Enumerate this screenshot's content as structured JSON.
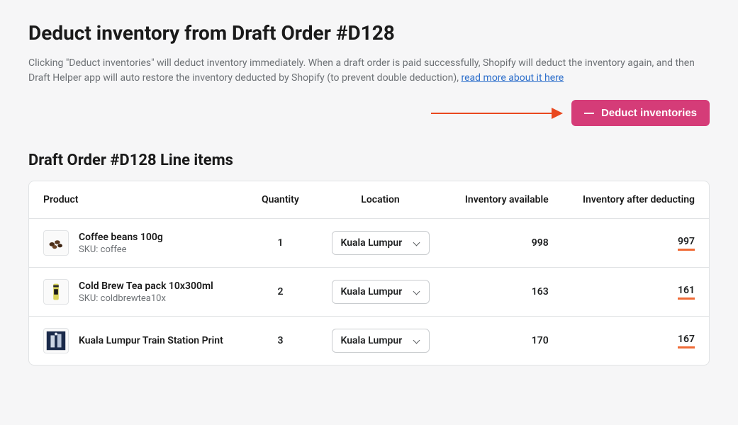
{
  "page": {
    "title": "Deduct inventory from Draft Order #D128",
    "description_pre": "Clicking \"Deduct inventories\" will deduct inventory immediately. When a draft order is paid successfully, Shopify will deduct the inventory again, and then Draft Helper app will auto restore the inventory deducted by Shopify (to prevent double deduction), ",
    "description_link": "read more about it here"
  },
  "actions": {
    "deduct_label": "Deduct inventories"
  },
  "table": {
    "title": "Draft Order #D128 Line items",
    "cols": {
      "product": "Product",
      "quantity": "Quantity",
      "location": "Location",
      "available": "Inventory available",
      "after": "Inventory after deducting"
    },
    "rows": [
      {
        "name": "Coffee beans 100g",
        "sku_label": "SKU: coffee",
        "qty": "1",
        "location": "Kuala Lumpur",
        "available": "998",
        "after": "997",
        "thumb": "beans"
      },
      {
        "name": "Cold Brew Tea pack 10x300ml",
        "sku_label": "SKU: coldbrewtea10x",
        "qty": "2",
        "location": "Kuala Lumpur",
        "available": "163",
        "after": "161",
        "thumb": "bottle"
      },
      {
        "name": "Kuala Lumpur Train Station Print",
        "sku_label": "",
        "qty": "3",
        "location": "Kuala Lumpur",
        "available": "170",
        "after": "167",
        "thumb": "print"
      }
    ]
  }
}
